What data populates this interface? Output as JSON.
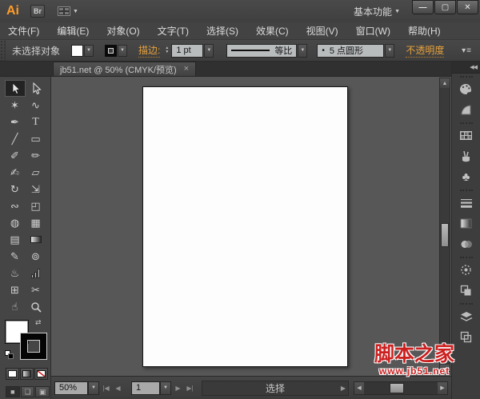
{
  "titlebar": {
    "logo": "Ai",
    "bridge_label": "Br",
    "workspace": "基本功能",
    "minimize_glyph": "—",
    "maximize_glyph": "▢",
    "close_glyph": "✕"
  },
  "menubar": {
    "items": [
      "文件(F)",
      "编辑(E)",
      "对象(O)",
      "文字(T)",
      "选择(S)",
      "效果(C)",
      "视图(V)",
      "窗口(W)",
      "帮助(H)"
    ]
  },
  "controlbar": {
    "no_selection": "未选择对象",
    "stroke_label": "描边:",
    "stroke_width": "1 pt",
    "profile": "等比",
    "brush_dot": "•",
    "brush": "5 点圆形",
    "opacity_label": "不透明度",
    "panel_menu_glyph": "▾≡"
  },
  "tab": {
    "title": "jb51.net @ 50% (CMYK/预览)",
    "close_glyph": "×"
  },
  "toolbar": {
    "tools": [
      {
        "name": "selection",
        "glyph": ""
      },
      {
        "name": "direct-selection",
        "glyph": ""
      },
      {
        "name": "magic-wand",
        "glyph": "✶"
      },
      {
        "name": "lasso",
        "glyph": "∿"
      },
      {
        "name": "pen",
        "glyph": "✒"
      },
      {
        "name": "type",
        "glyph": "T"
      },
      {
        "name": "line-segment",
        "glyph": "╱"
      },
      {
        "name": "rectangle",
        "glyph": "▭"
      },
      {
        "name": "paintbrush",
        "glyph": "✐"
      },
      {
        "name": "pencil",
        "glyph": "✏"
      },
      {
        "name": "blob-brush",
        "glyph": "✍"
      },
      {
        "name": "eraser",
        "glyph": "▱"
      },
      {
        "name": "rotate",
        "glyph": "↻"
      },
      {
        "name": "scale",
        "glyph": "⇲"
      },
      {
        "name": "width",
        "glyph": "∾"
      },
      {
        "name": "free-transform",
        "glyph": "◰"
      },
      {
        "name": "shape-builder",
        "glyph": "◍"
      },
      {
        "name": "perspective-grid",
        "glyph": "▦"
      },
      {
        "name": "mesh",
        "glyph": "▤"
      },
      {
        "name": "gradient",
        "glyph": ""
      },
      {
        "name": "eyedropper",
        "glyph": "✎"
      },
      {
        "name": "blend",
        "glyph": "⊚"
      },
      {
        "name": "symbol-sprayer",
        "glyph": "♨"
      },
      {
        "name": "column-graph",
        "glyph": ""
      },
      {
        "name": "artboard",
        "glyph": "⊞"
      },
      {
        "name": "slice",
        "glyph": "✂"
      },
      {
        "name": "hand",
        "glyph": "☝"
      },
      {
        "name": "zoom",
        "glyph": ""
      }
    ],
    "swap_glyph": "⇄",
    "mode_normal_glyph": "■",
    "mode_behind_glyph": "❏",
    "mode_inside_glyph": "▣"
  },
  "dock": {
    "expand_glyph": "◀◀",
    "symbols_glyph": "♣",
    "groups": [
      [
        "color",
        "color-guide"
      ],
      [
        "swatches",
        "brushes",
        "symbols"
      ],
      [
        "stroke",
        "gradient",
        "transparency"
      ],
      [
        "appearance",
        "graphic-styles"
      ],
      [
        "layers",
        "artboards"
      ]
    ]
  },
  "statusbar": {
    "zoom": "50%",
    "artboard_number": "1",
    "status": "选择",
    "nav_first": "|◀",
    "nav_prev": "◀",
    "nav_next": "▶",
    "nav_last": "▶|"
  },
  "icons": {
    "down": "▼",
    "up": "▲",
    "left": "◀",
    "right": "▶",
    "stepper_up": "▲",
    "stepper_down": "▼"
  },
  "watermark": {
    "title": "脚本之家",
    "url": "www.jb51.net"
  },
  "colors": {
    "accent_orange": "#e8a33d",
    "chrome": "#434343",
    "canvas": "#575757",
    "watermark_red": "#cc2020"
  }
}
